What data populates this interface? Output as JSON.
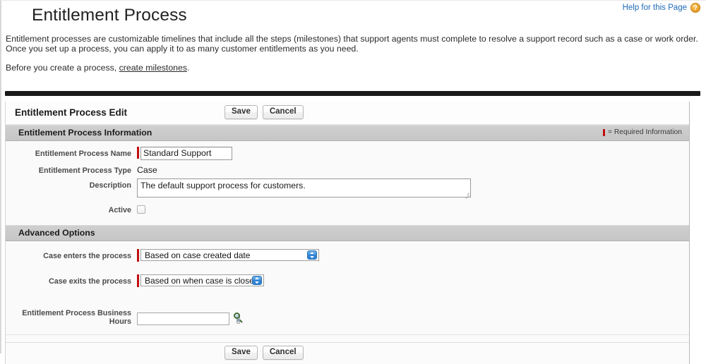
{
  "help": {
    "link_label": "Help for this Page",
    "icon": "help-question-icon",
    "icon_glyph": "?"
  },
  "page": {
    "title": "Entitlement Process",
    "intro_paragraph_1": "Entitlement processes are customizable timelines that include all the steps (milestones) that support agents must complete to resolve a support record such as a case or work order. Once you set up a process, you can apply it to as many customer entitlements as you need.",
    "intro_paragraph_2_prefix": "Before you create a process, ",
    "intro_link": "create milestones",
    "intro_paragraph_2_suffix": "."
  },
  "edit_panel": {
    "heading": "Entitlement Process Edit",
    "save_label": "Save",
    "cancel_label": "Cancel"
  },
  "sections": {
    "information": {
      "title": "Entitlement Process Information",
      "required_legend": "= Required Information"
    },
    "advanced": {
      "title": "Advanced Options"
    }
  },
  "fields": {
    "process_name": {
      "label": "Entitlement Process Name",
      "value": "Standard Support",
      "placeholder": "",
      "required": true
    },
    "process_type": {
      "label": "Entitlement Process Type",
      "value": "Case",
      "required": false
    },
    "description": {
      "label": "Description",
      "value": "The default support process for customers.",
      "placeholder": "",
      "required": false
    },
    "active": {
      "label": "Active",
      "checked": false
    },
    "case_enters": {
      "label": "Case enters the process",
      "value": "Based on case created date",
      "required": true
    },
    "case_exits": {
      "label": "Case exits the process",
      "value": "Based on when case is closed",
      "required": true
    },
    "business_hours": {
      "label": "Entitlement Process Business Hours",
      "label_line1": "Entitlement Process Business",
      "label_line2": "Hours",
      "value": "",
      "placeholder": "",
      "lookup_icon": "magnifying-glass-icon",
      "info_icon": "info-icon",
      "info_glyph": "i"
    }
  },
  "footer": {
    "save_label": "Save",
    "cancel_label": "Cancel"
  },
  "colors": {
    "required_marker": "#c10f0f",
    "link": "#1f6bb8",
    "section_bar": "#c8c8c8",
    "select_arrow_blue": "#2d7fcf",
    "help_icon_orange": "#f0a937"
  }
}
